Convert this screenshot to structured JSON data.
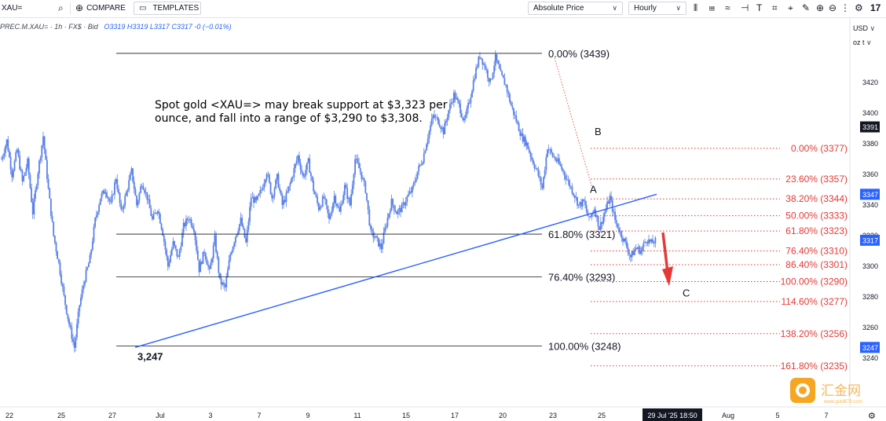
{
  "toolbar": {
    "symbol_value": "XAU=",
    "compare_label": "COMPARE",
    "templates_label": "TEMPLATES",
    "price_mode": "Absolute Price",
    "interval": "Hourly"
  },
  "legend": {
    "name": "PREC.M.XAU= · 1h · FX$ · Bid",
    "ohlc": "O3319 H3319 L3317 C3317 -0 (−0.01%)"
  },
  "currency": "USD",
  "unit": "oz t",
  "colors": {
    "candle": "#5b80e8",
    "trendline": "#2962ff",
    "fib_red": "#e53935",
    "fib_black": "#131722",
    "arrow": "#e53935",
    "price_tag": "#2962ff"
  },
  "annotation": {
    "line1": "Spot gold <XAU=> may break support at $3,323 per",
    "line2": "ounce, and fall into a range of $3,290 to $3,308."
  },
  "chart_data": {
    "type": "candlestick",
    "series_note": "Hourly spot gold (XAU=)",
    "y_ticks": [
      3240,
      3260,
      3280,
      3300,
      3320,
      3340,
      3360,
      3380,
      3400,
      3420
    ],
    "ylim": [
      3222,
      3450
    ],
    "x_ticks": [
      "22",
      "25",
      "27",
      "Jul",
      "3",
      "7",
      "9",
      "11",
      "15",
      "17",
      "20",
      "23",
      "25",
      "29 Jul '25  18:50",
      "Aug",
      "5",
      "7"
    ],
    "price_tags": [
      {
        "label": "3391",
        "value": 3391,
        "style": "dark"
      },
      {
        "label": "3347",
        "value": 3347,
        "style": "blue"
      },
      {
        "label": "3317",
        "value": 3317,
        "style": "blue"
      },
      {
        "label": "3247",
        "value": 3247,
        "style": "blue"
      }
    ],
    "fib_retracement_black": [
      {
        "label": "0.00% (3439)",
        "value": 3439
      },
      {
        "label": "61.80% (3321)",
        "value": 3321
      },
      {
        "label": "76.40% (3293)",
        "value": 3293
      },
      {
        "label": "100.00% (3248)",
        "value": 3248
      }
    ],
    "fib_extension_red": [
      {
        "label": "0.00% (3377)",
        "value": 3377
      },
      {
        "label": "23.60% (3357)",
        "value": 3357
      },
      {
        "label": "38.20% (3344)",
        "value": 3344
      },
      {
        "label": "50.00% (3333)",
        "value": 3333
      },
      {
        "label": "61.80% (3323)",
        "value": 3323
      },
      {
        "label": "76.40% (3310)",
        "value": 3310
      },
      {
        "label": "86.40% (3301)",
        "value": 3301
      },
      {
        "label": "100.00% (3290)",
        "value": 3290
      },
      {
        "label": "114.60% (3277)",
        "value": 3277
      },
      {
        "label": "138.20% (3256)",
        "value": 3256
      },
      {
        "label": "161.80% (3235)",
        "value": 3235
      }
    ],
    "wave_labels": [
      {
        "text": "A",
        "value": 3351
      },
      {
        "text": "B",
        "value": 3380
      },
      {
        "text": "C",
        "value": 3288
      },
      {
        "text": "3,247",
        "value": 3247
      }
    ],
    "trendline": {
      "from": 3247,
      "to": 3347
    },
    "path": [
      3370,
      3382,
      3360,
      3376,
      3355,
      3368,
      3335,
      3362,
      3385,
      3350,
      3320,
      3302,
      3280,
      3262,
      3247,
      3275,
      3292,
      3305,
      3330,
      3345,
      3350,
      3340,
      3358,
      3335,
      3348,
      3362,
      3340,
      3355,
      3345,
      3330,
      3338,
      3322,
      3300,
      3315,
      3305,
      3326,
      3332,
      3325,
      3298,
      3310,
      3296,
      3318,
      3290,
      3286,
      3308,
      3320,
      3330,
      3315,
      3345,
      3342,
      3350,
      3362,
      3345,
      3358,
      3340,
      3348,
      3360,
      3372,
      3358,
      3368,
      3350,
      3338,
      3345,
      3330,
      3346,
      3335,
      3352,
      3340,
      3370,
      3362,
      3350,
      3322,
      3318,
      3312,
      3328,
      3342,
      3335,
      3338,
      3345,
      3350,
      3362,
      3370,
      3385,
      3398,
      3395,
      3388,
      3402,
      3412,
      3405,
      3394,
      3408,
      3425,
      3438,
      3430,
      3420,
      3436,
      3425,
      3418,
      3405,
      3395,
      3385,
      3380,
      3370,
      3362,
      3351,
      3378,
      3372,
      3368,
      3362,
      3355,
      3348,
      3340,
      3342,
      3330,
      3338,
      3325,
      3335,
      3345,
      3330,
      3322,
      3315,
      3306,
      3312,
      3310,
      3318,
      3315,
      3317
    ]
  }
}
